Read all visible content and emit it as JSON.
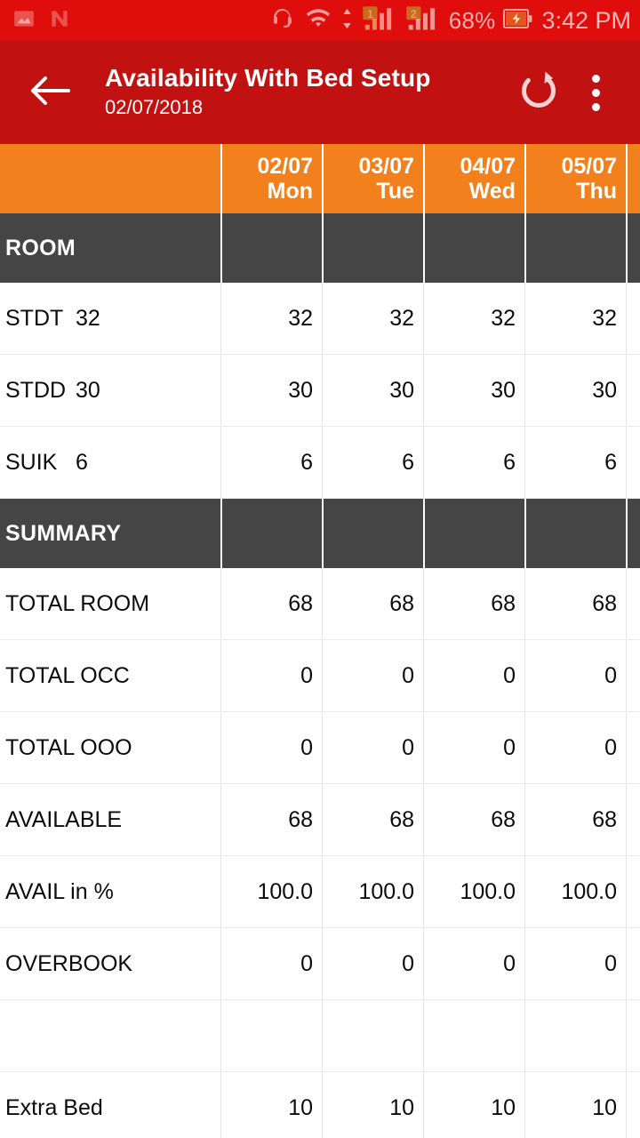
{
  "statusbar": {
    "left_icons": [
      "gallery-icon",
      "n-app-icon"
    ],
    "right_icons": [
      "headset-icon",
      "wifi-icon",
      "data-transfer-icon",
      "signal-sim1-icon",
      "signal-sim2-icon"
    ],
    "sim1_label": "1",
    "sim2_label": "2",
    "battery_percent": "68%",
    "battery_icon": "battery-charging-icon",
    "time": "3:42 PM",
    "bg_color": "#e00d0d",
    "fg_color": "#f3b0b0"
  },
  "appbar": {
    "back_icon": "arrow-left-icon",
    "title": "Availability With Bed Setup",
    "subtitle": "02/07/2018",
    "refresh_icon": "refresh-icon",
    "overflow_icon": "more-vertical-icon",
    "bg_color": "#c21111"
  },
  "theme": {
    "header_orange": "#f2801c",
    "section_gray": "#454545",
    "divider_red": "#9d1f1f",
    "row_border": "#e9e9e9"
  },
  "table": {
    "columns": [
      {
        "date": "02/07",
        "dow": "Mon"
      },
      {
        "date": "03/07",
        "dow": "Tue"
      },
      {
        "date": "04/07",
        "dow": "Wed"
      },
      {
        "date": "05/07",
        "dow": "Thu"
      }
    ],
    "sections": [
      {
        "title": "ROOM"
      },
      {
        "title": "SUMMARY"
      }
    ],
    "room_rows": [
      {
        "code": "STDT",
        "setup": "32",
        "values": [
          "32",
          "32",
          "32",
          "32"
        ]
      },
      {
        "code": "STDD",
        "setup": "30",
        "values": [
          "30",
          "30",
          "30",
          "30"
        ]
      },
      {
        "code": "SUIK",
        "setup": "6",
        "values": [
          "6",
          "6",
          "6",
          "6"
        ]
      }
    ],
    "summary_rows": [
      {
        "label": "TOTAL ROOM",
        "values": [
          "68",
          "68",
          "68",
          "68"
        ]
      },
      {
        "label": "TOTAL OCC",
        "values": [
          "0",
          "0",
          "0",
          "0"
        ]
      },
      {
        "label": "TOTAL OOO",
        "values": [
          "0",
          "0",
          "0",
          "0"
        ]
      },
      {
        "label": "AVAILABLE",
        "values": [
          "68",
          "68",
          "68",
          "68"
        ]
      },
      {
        "label": "AVAIL in %",
        "values": [
          "100.0",
          "100.0",
          "100.0",
          "100.0"
        ]
      },
      {
        "label": "OVERBOOK",
        "values": [
          "0",
          "0",
          "0",
          "0"
        ]
      },
      {
        "label": "",
        "values": [
          "",
          "",
          "",
          ""
        ]
      },
      {
        "label": "Extra Bed",
        "values": [
          "10",
          "10",
          "10",
          "10"
        ]
      }
    ]
  }
}
